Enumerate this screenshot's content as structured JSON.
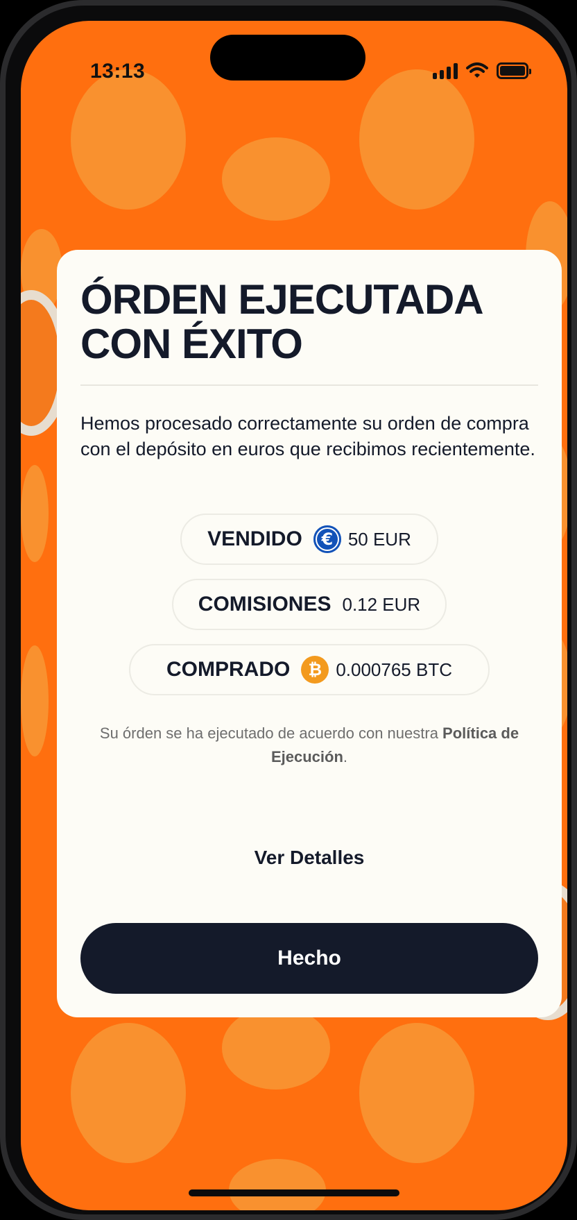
{
  "status_bar": {
    "time": "13:13",
    "icons": [
      "cellular-signal-icon",
      "wifi-icon",
      "battery-icon"
    ]
  },
  "theme": {
    "background": "#ff6f0f",
    "blob": "#f89533",
    "card": "#fdfcf6",
    "text_dark": "#141a2a",
    "euro_coin": "#1252b8",
    "bitcoin_coin": "#f39a1e"
  },
  "card": {
    "title": "ÓRDEN EJECUTADA CON ÉXITO",
    "message": "Hemos procesado correctamente su orden de compra con el depósito en euros que recibimos recientemente.",
    "summary": [
      {
        "label": "VENDIDO",
        "icon": "euro-coin-icon",
        "icon_glyph": "€",
        "value": "50 EUR"
      },
      {
        "label": "COMISIONES",
        "value": "0.12 EUR"
      },
      {
        "label": "COMPRADO",
        "icon": "bitcoin-coin-icon",
        "icon_glyph": "₿",
        "value": "0.000765 BTC"
      }
    ],
    "note_before": "Su órden se ha ejecutado de acuerdo con nuestra ",
    "note_link": "Política de Ejecución",
    "note_after": ".",
    "details_link": "Ver Detalles",
    "done_button": "Hecho"
  }
}
